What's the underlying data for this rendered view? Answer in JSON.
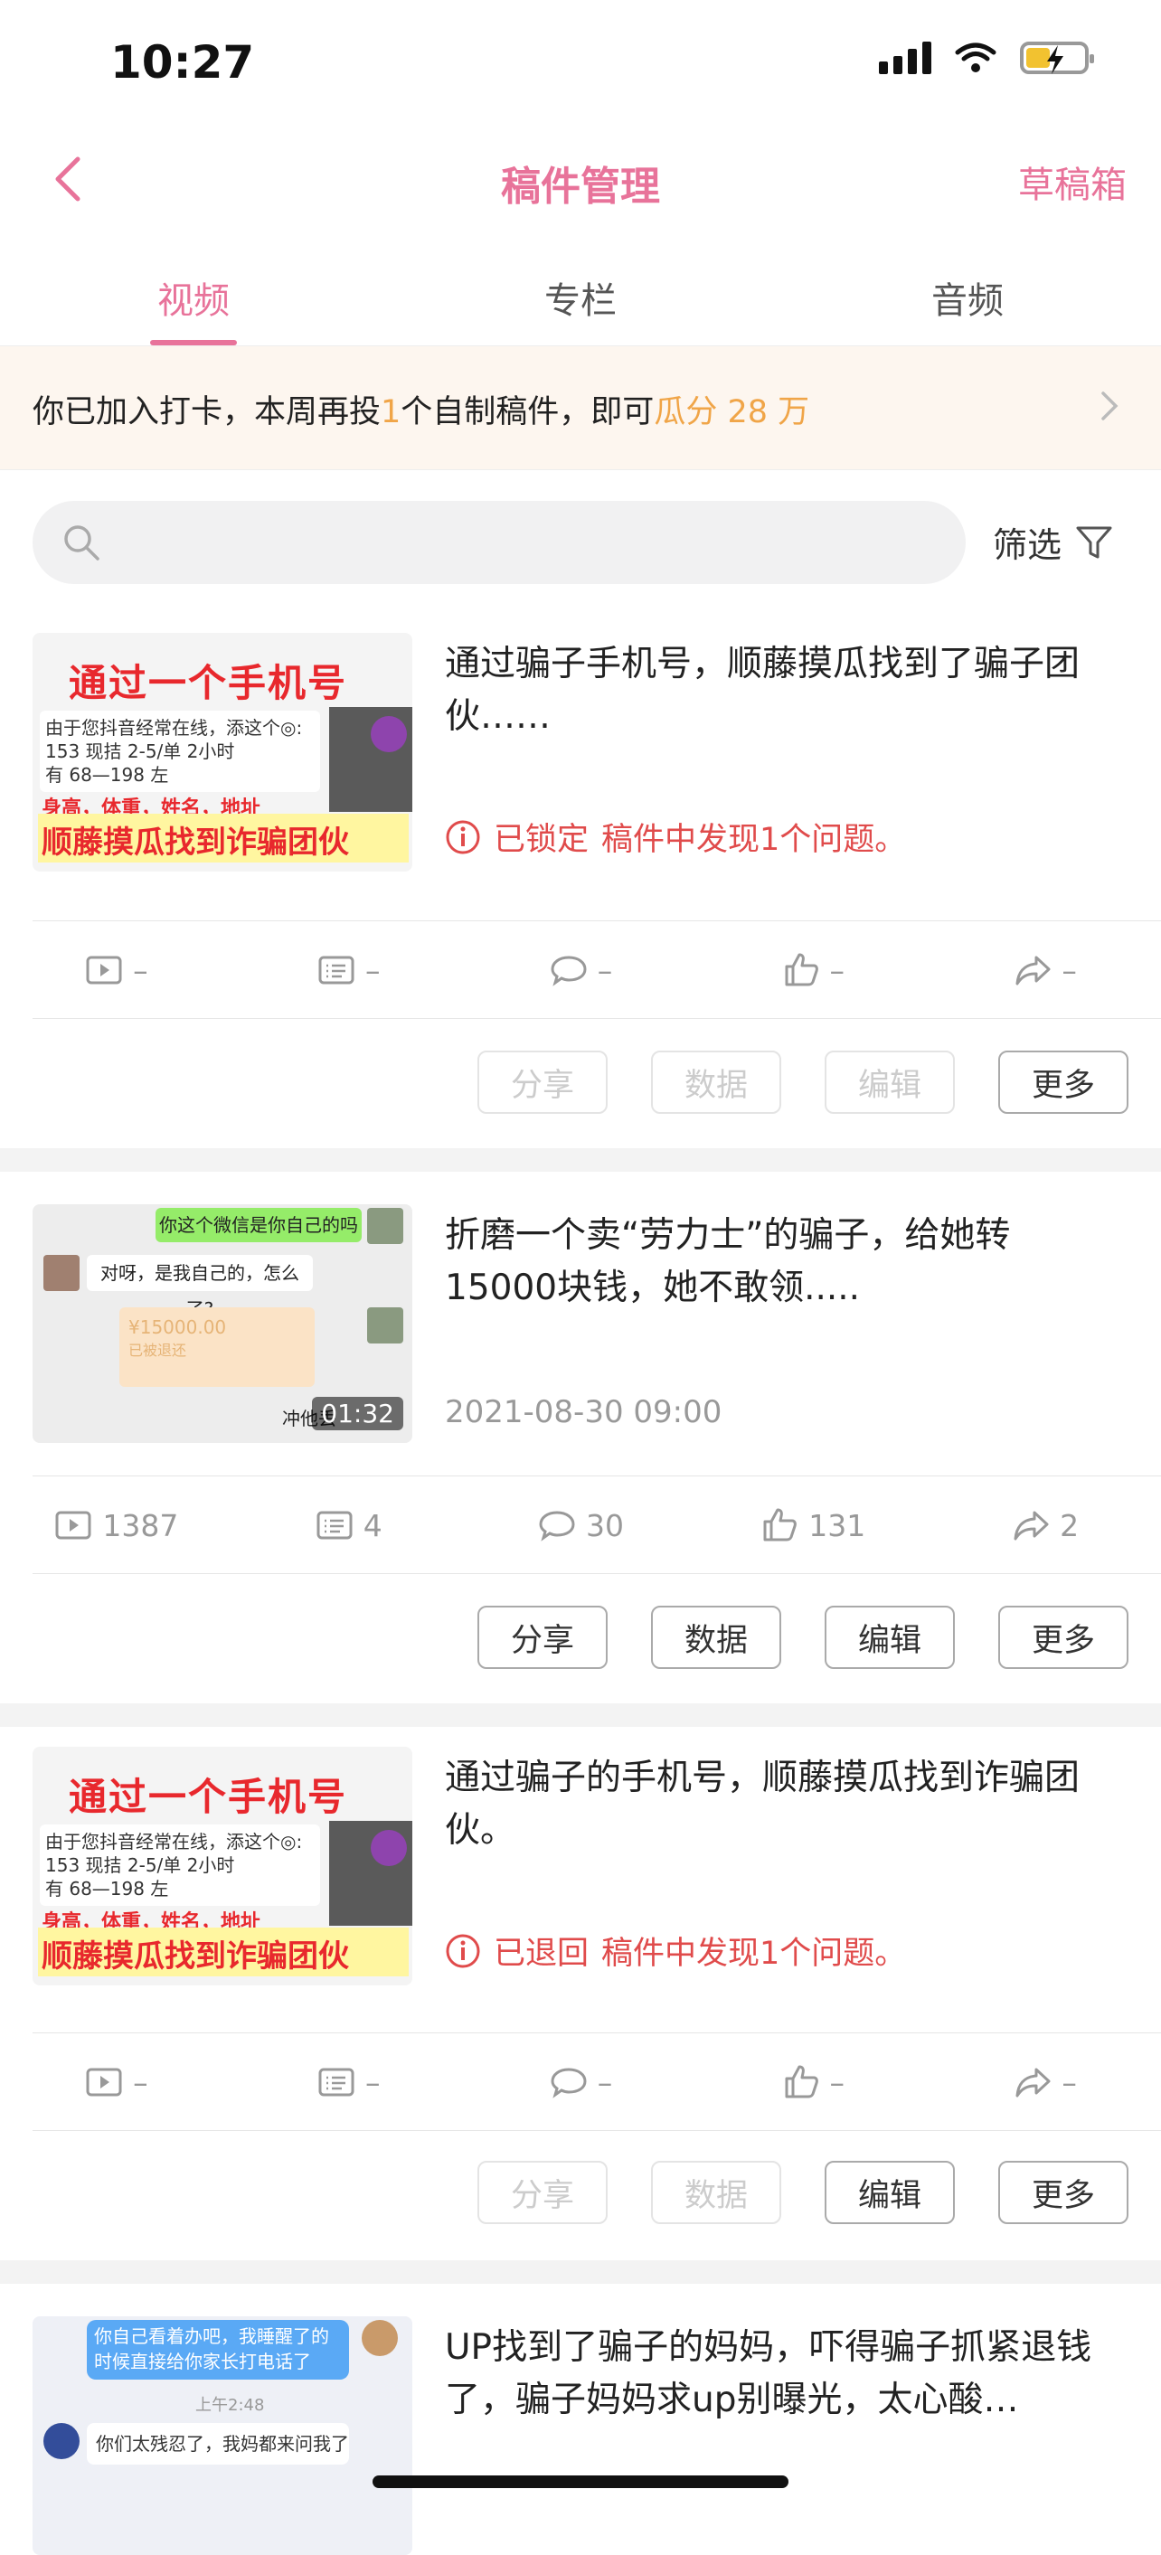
{
  "status": {
    "time": "10:27"
  },
  "nav": {
    "title": "稿件管理",
    "drafts": "草稿箱"
  },
  "tabs": [
    {
      "label": "视频",
      "active": true
    },
    {
      "label": "专栏",
      "active": false
    },
    {
      "label": "音频",
      "active": false
    }
  ],
  "banner": {
    "prefix": "你已加入打卡，本周再投",
    "count": "1",
    "middle": "个自制稿件，即可",
    "reward": "瓜分 28 万"
  },
  "search": {
    "placeholder": "",
    "filter_label": "筛选"
  },
  "colors": {
    "accent": "#e8739a",
    "error": "#e04b4b",
    "highlight": "#f0a548"
  },
  "cards": [
    {
      "title": "通过骗子手机号，顺藤摸瓜找到了骗子团伙……",
      "status_tag": "已锁定",
      "status_msg": "稿件中发现1个问题。",
      "thumb": {
        "headline": "通过一个手机号",
        "line1": "由于您抖音经常在线，添这个◎:",
        "line2": "153          现拮 2-5/单 2小时",
        "line3": "有 68—198 左",
        "tags": "身高，体重，姓名，地址",
        "bottom": "顺藤摸瓜找到诈骗团伙"
      },
      "stats": {
        "plays": "–",
        "danmaku": "–",
        "comments": "–",
        "likes": "–",
        "shares": "–"
      },
      "actions": {
        "share": "分享",
        "data": "数据",
        "edit": "编辑",
        "more": "更多"
      }
    },
    {
      "title": "折磨一个卖“劳力士”的骗子，给她转15000块钱，她不敢领.....",
      "date": "2021-08-30 09:00",
      "thumb": {
        "bubble1": "你这个微信是你自己的吗",
        "bubble2": "对呀，是我自己的，怎么了?",
        "pay": "¥15000.00",
        "pay_sub": "已被退还",
        "duration": "01:32",
        "caption": "冲他丢"
      },
      "stats": {
        "plays": "1387",
        "danmaku": "4",
        "comments": "30",
        "likes": "131",
        "shares": "2"
      },
      "actions": {
        "share": "分享",
        "data": "数据",
        "edit": "编辑",
        "more": "更多"
      }
    },
    {
      "title": "通过骗子的手机号，顺藤摸瓜找到诈骗团伙。",
      "status_tag": "已退回",
      "status_msg": "稿件中发现1个问题。",
      "thumb": {
        "headline": "通过一个手机号",
        "line1": "由于您抖音经常在线，添这个◎:",
        "line2": "153          现拮 2-5/单 2小时",
        "line3": "有 68—198 左",
        "tags": "身高，体重，姓名，地址",
        "bottom": "顺藤摸瓜找到诈骗团伙"
      },
      "stats": {
        "plays": "–",
        "danmaku": "–",
        "comments": "–",
        "likes": "–",
        "shares": "–"
      },
      "actions": {
        "share": "分享",
        "data": "数据",
        "edit": "编辑",
        "more": "更多"
      }
    },
    {
      "title": "UP找到了骗子的妈妈，吓得骗子抓紧退钱了，骗子妈妈求up别曝光，太心酸…",
      "thumb": {
        "bubble1": "你自己看着办吧，我睡醒了的时候直接给你家长打电话了",
        "time": "上午2:48",
        "bubble2": "你们太残忍了，我妈都来问我了"
      }
    }
  ]
}
